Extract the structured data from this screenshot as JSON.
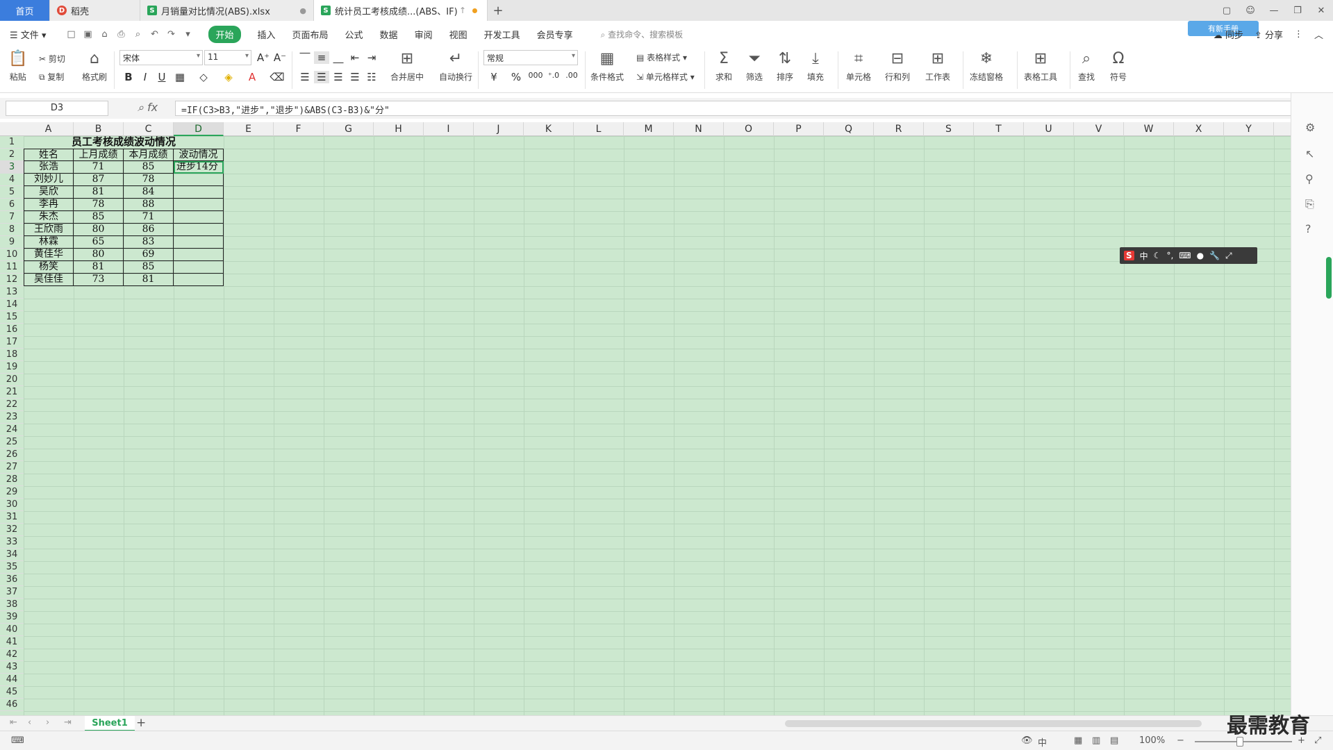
{
  "tabs": {
    "home": "首页",
    "t1": "稻壳",
    "t2": "月销量对比情况(ABS).xlsx",
    "t3": "统计员工考核成绩...(ABS、IF)"
  },
  "menus": [
    "文件",
    "开始",
    "插入",
    "页面布局",
    "公式",
    "数据",
    "审阅",
    "视图",
    "开发工具",
    "会员专享"
  ],
  "search_cmd": "查找命令、搜索模板",
  "right_menu": {
    "sync": "同步",
    "share": "分享",
    "badge": "有新手册"
  },
  "ribbon": {
    "paste": "粘贴",
    "cut": "剪切",
    "copy": "复制",
    "format_painter": "格式刷",
    "font_name": "宋体",
    "font_size": "11",
    "merge_center": "合并居中",
    "wrap_text": "自动换行",
    "number_format": "常规",
    "cond_format": "条件格式",
    "table_style": "表格样式",
    "cell_style": "单元格样式",
    "sum": "求和",
    "filter": "筛选",
    "sort": "排序",
    "fill": "填充",
    "cell": "单元格",
    "row_col": "行和列",
    "worksheet": "工作表",
    "freeze": "冻结窗格",
    "table_tools": "表格工具",
    "find": "查找",
    "symbol": "符号"
  },
  "namebox": "D3",
  "formula": "=IF(C3>B3,\"进步\",\"退步\")&ABS(C3-B3)&\"分\"",
  "columns": [
    "A",
    "B",
    "C",
    "D",
    "E",
    "F",
    "G",
    "H",
    "I",
    "J",
    "K",
    "L",
    "M",
    "N",
    "O",
    "P",
    "Q",
    "R",
    "S",
    "T",
    "U",
    "V",
    "W",
    "X",
    "Y"
  ],
  "table": {
    "title": "员工考核成绩波动情况",
    "headers": [
      "姓名",
      "上月成绩",
      "本月成绩",
      "波动情况"
    ],
    "rows": [
      [
        "张浩",
        "71",
        "85",
        "进步14分"
      ],
      [
        "刘妙儿",
        "87",
        "78",
        ""
      ],
      [
        "吴欣",
        "81",
        "84",
        ""
      ],
      [
        "李冉",
        "78",
        "88",
        ""
      ],
      [
        "朱杰",
        "85",
        "71",
        ""
      ],
      [
        "王欣雨",
        "80",
        "86",
        ""
      ],
      [
        "林霖",
        "65",
        "83",
        ""
      ],
      [
        "黄佳华",
        "80",
        "69",
        ""
      ],
      [
        "杨笑",
        "81",
        "85",
        ""
      ],
      [
        "吴佳佳",
        "73",
        "81",
        ""
      ]
    ]
  },
  "ime": {
    "s": "S",
    "mode": "中"
  },
  "sheet": {
    "name": "Sheet1"
  },
  "status": {
    "zoom": "100%",
    "input": "中"
  },
  "watermark": "最需教育",
  "colors": {
    "accent": "#2aa55a",
    "grid_bg": "#cce8cf",
    "tab_blue": "#3b7ddd"
  }
}
